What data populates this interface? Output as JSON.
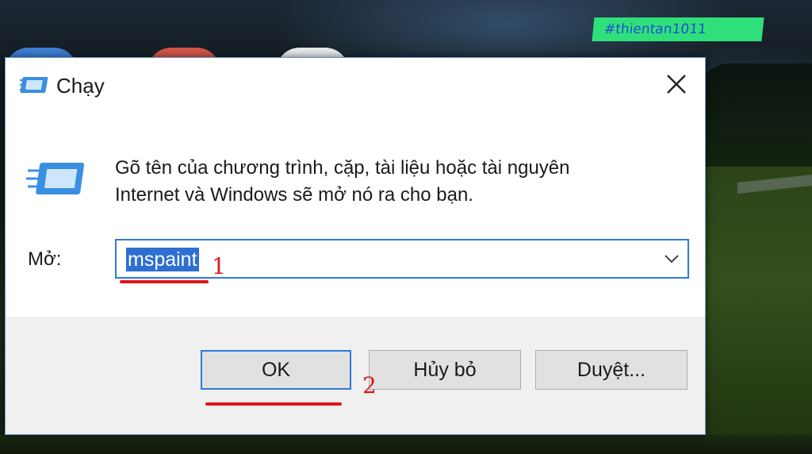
{
  "watermark": "#thientan1011",
  "dialog": {
    "title": "Chạy",
    "description_line1": "Gõ tên của chương trình, cặp, tài liệu hoặc tài nguyên",
    "description_line2": "Internet và Windows sẽ mở nó ra cho bạn.",
    "open_label": "Mở:",
    "open_value": "mspaint",
    "buttons": {
      "ok": "OK",
      "cancel": "Hủy bỏ",
      "browse": "Duyệt..."
    }
  },
  "annotations": {
    "step1": "1",
    "step2": "2"
  },
  "icons": {
    "title": "run-icon",
    "close": "close-icon",
    "dropdown": "chevron-down-icon"
  },
  "colors": {
    "accent": "#2e7bd4",
    "annotation": "#e0141c",
    "watermark_bg": "#2fe07a"
  }
}
